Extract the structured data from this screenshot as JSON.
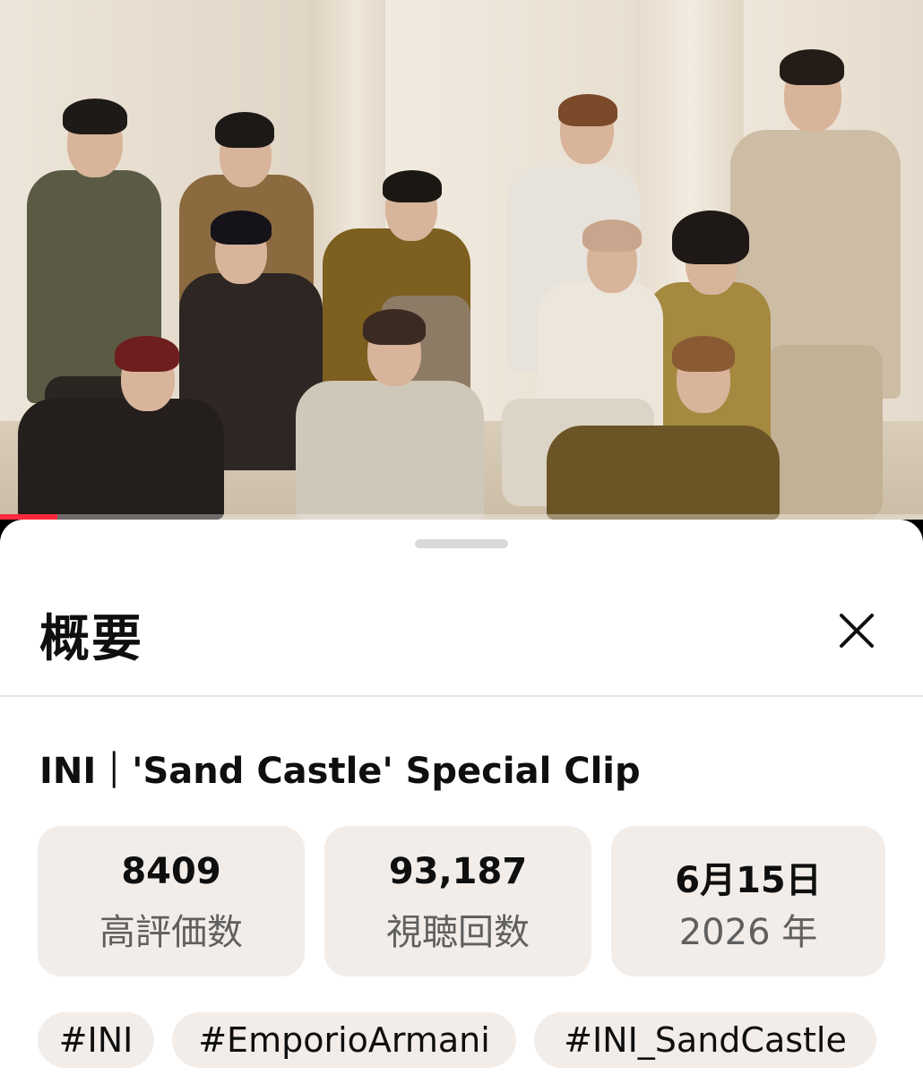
{
  "player": {
    "thumbnail_alt": "group photo",
    "progress_fraction": 0.062,
    "progress_color": "#ff2a3d"
  },
  "sheet": {
    "title": "概要",
    "close_icon": "close-icon",
    "video_title": "INI｜'Sand Castle' Special Clip",
    "stats": [
      {
        "value": "8409",
        "label": "高評価数"
      },
      {
        "value": "93,187",
        "label": "視聴回数"
      },
      {
        "value": "6月15日",
        "label": "2026 年"
      }
    ],
    "hashtags": [
      "#INI",
      "#EmporioArmani",
      "#INI_SandCastle"
    ]
  }
}
